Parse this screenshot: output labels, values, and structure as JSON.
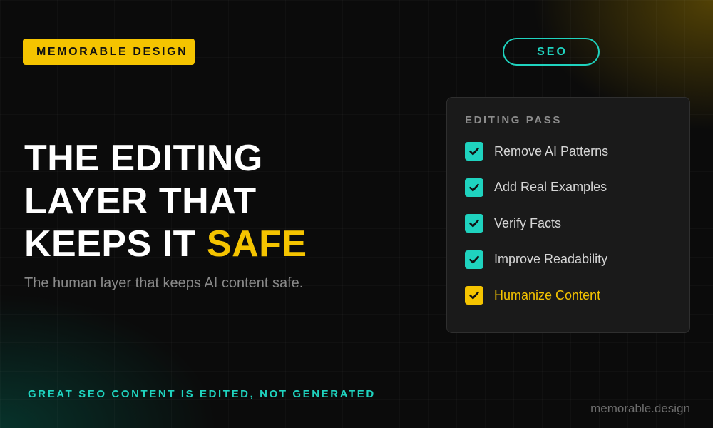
{
  "brand": {
    "badge_label": "MEMORABLE DESIGN",
    "watermark": "memorable.design"
  },
  "tag": {
    "label": "SEO"
  },
  "hero": {
    "headline_lines": [
      "THE EDITING",
      "LAYER THAT",
      "KEEPS IT"
    ],
    "headline_accent": "SAFE",
    "subtitle": "The human layer that keeps AI content safe."
  },
  "panel": {
    "title": "EDITING PASS",
    "items": [
      {
        "label": "Remove AI Patterns",
        "checked": true,
        "highlight": false
      },
      {
        "label": "Add Real Examples",
        "checked": true,
        "highlight": false
      },
      {
        "label": "Verify Facts",
        "checked": true,
        "highlight": false
      },
      {
        "label": "Improve Readability",
        "checked": true,
        "highlight": false
      },
      {
        "label": "Humanize Content",
        "checked": true,
        "highlight": true
      }
    ]
  },
  "footer": {
    "tagline": "GREAT SEO CONTENT IS EDITED, NOT GENERATED"
  },
  "icons": {
    "checkbox": "check-icon"
  },
  "colors": {
    "accent_yellow": "#f5c400",
    "accent_teal": "#1fd3bf",
    "background": "#0b0b0b",
    "panel_background": "#1a1a1a"
  }
}
